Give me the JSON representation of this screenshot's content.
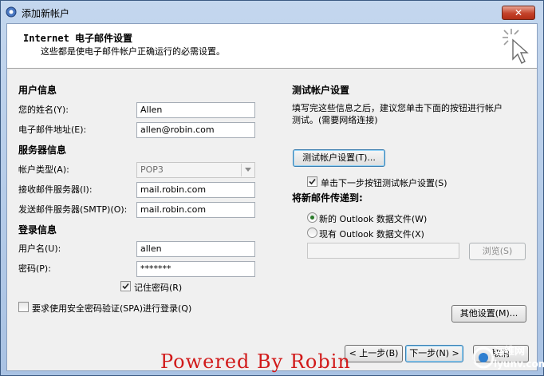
{
  "window": {
    "title": "添加新帐户",
    "close_icon": "close-icon"
  },
  "header": {
    "title": "Internet 电子邮件设置",
    "subtitle": "这些都是使电子邮件帐户正确运行的必需设置。"
  },
  "user_info": {
    "heading": "用户信息",
    "name_label": "您的姓名(Y):",
    "name_value": "Allen",
    "email_label": "电子邮件地址(E):",
    "email_value": "allen@robin.com"
  },
  "server_info": {
    "heading": "服务器信息",
    "account_type_label": "帐户类型(A):",
    "account_type_value": "POP3",
    "incoming_label": "接收邮件服务器(I):",
    "incoming_value": "mail.robin.com",
    "outgoing_label": "发送邮件服务器(SMTP)(O):",
    "outgoing_value": "mail.robin.com"
  },
  "login_info": {
    "heading": "登录信息",
    "username_label": "用户名(U):",
    "username_value": "allen",
    "password_label": "密码(P):",
    "password_value": "*******",
    "remember_label": "记住密码(R)",
    "remember_checked": true,
    "spa_label": "要求使用安全密码验证(SPA)进行登录(Q)",
    "spa_checked": false
  },
  "test_settings": {
    "heading": "测试帐户设置",
    "description_line1": "填写完这些信息之后，建议您单击下面的按钮进行帐户",
    "description_line2": "测试。(需要网络连接)",
    "test_button": "测试帐户设置(T)...",
    "auto_test_label": "单击下一步按钮测试帐户设置(S)",
    "auto_test_checked": true
  },
  "delivery": {
    "heading": "将新邮件传递到:",
    "new_file_label": "新的 Outlook 数据文件(W)",
    "existing_file_label": "现有 Outlook 数据文件(X)",
    "selected": "new",
    "path_value": "",
    "browse_button": "浏览(S)"
  },
  "more_settings_button": "其他设置(M)...",
  "footer": {
    "back_button": "< 上一步(B)",
    "next_button": "下一步(N) >",
    "cancel_button": "取消"
  },
  "watermark": "Powered By Robin",
  "brand": {
    "name": "运维网",
    "domain": "iyunv.com"
  }
}
